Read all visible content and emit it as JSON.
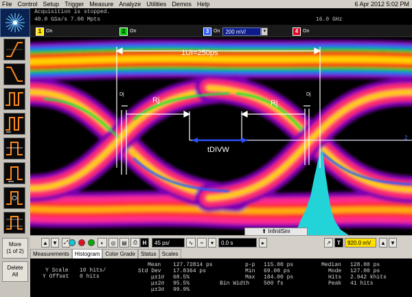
{
  "menu": {
    "items": [
      "File",
      "Control",
      "Setup",
      "Trigger",
      "Measure",
      "Analyze",
      "Utilities",
      "Demos",
      "Help"
    ],
    "datetime": "6 Apr 2012  5:02 PM"
  },
  "status": {
    "line1": "Acquisition is stopped.",
    "line2": "40.0 GSa/s   7.00 Mpts",
    "bandwidth": "16.0 GHz"
  },
  "channels": [
    {
      "num": "1",
      "state": "On",
      "color": "#ffe000"
    },
    {
      "num": "2",
      "state": "On",
      "color": "#00c800"
    },
    {
      "num": "3",
      "state": "On",
      "color": "#3060ff",
      "scale": "200 mV/"
    },
    {
      "num": "4",
      "state": "On",
      "color": "#e00020"
    }
  ],
  "sidebar": {
    "more_label": "More\n(1 of 2)",
    "delete_label": "Delete\nAll"
  },
  "display": {
    "ui_label": "1UI=250ps",
    "rj_left": "Rj",
    "rj_right": "Rj",
    "dj_left": "Dj",
    "dj_right": "Dj",
    "tdivw": "tDIVW",
    "marker_2": "2"
  },
  "infinisim": {
    "label": "InfiniiSim"
  },
  "controls": {
    "h_label": "H",
    "timebase": "45 ps/",
    "delay": "0.0 s",
    "trigger_label": "T",
    "trigger_level": "920.0 mV"
  },
  "tabs": [
    "Measurements",
    "Histogram",
    "Color Grade",
    "Status",
    "Scales"
  ],
  "active_tab": "Histogram",
  "results": {
    "y_scale_label": "Y Scale",
    "y_scale_value": "10 hits/",
    "y_offset_label": "Y Offset",
    "y_offset_value": "0 hits",
    "mean_label": "Mean",
    "mean_value": "127.72814 ps",
    "stddev_label": "Std Dev",
    "stddev_value": "17.8364 ps",
    "s1_label": "μ±1σ",
    "s1_value": "68.5%",
    "s2_label": "μ±2σ",
    "s2_value": "95.5%",
    "s3_label": "μ±3σ",
    "s3_value": "99.9%",
    "pp_label": "p-p",
    "pp_value": "115.00 ps",
    "min_label": "Min",
    "min_value": "69.00 ps",
    "max_label": "Max",
    "max_value": "184.00 ps",
    "binw_label": "Bin Width",
    "binw_value": "500 fs",
    "median_label": "Median",
    "median_value": "128.00 ps",
    "mode_label": "Mode",
    "mode_value": "127.00 ps",
    "hits_label": "Hits",
    "hits_value": "2.942 khits",
    "peak_label": "Peak",
    "peak_value": "41 hits"
  }
}
